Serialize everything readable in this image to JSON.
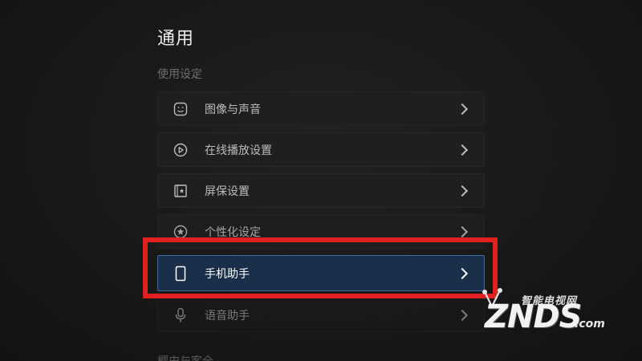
{
  "page": {
    "title": "通用",
    "section_label": "使用设定",
    "next_section_label": "樱史与客全"
  },
  "menu": {
    "items": [
      {
        "label": "图像与声音",
        "icon": "picture-sound-icon"
      },
      {
        "label": "在线播放设置",
        "icon": "play-circle-icon"
      },
      {
        "label": "屏保设置",
        "icon": "screensaver-icon"
      },
      {
        "label": "个性化设定",
        "icon": "star-badge-icon"
      },
      {
        "label": "手机助手",
        "icon": "phone-icon",
        "selected": true
      },
      {
        "label": "语音助手",
        "icon": "microphone-icon"
      }
    ]
  },
  "annotation": {
    "highlight_color": "#e32020"
  },
  "watermark": {
    "tagline": "智能电视网",
    "brand": "ZNDS",
    "domain": ".com"
  },
  "colors": {
    "background": "#181818",
    "selected_bg": "#1a2f4a",
    "selected_border": "#3d6aa3",
    "item_bg": "#1f1f1f"
  }
}
